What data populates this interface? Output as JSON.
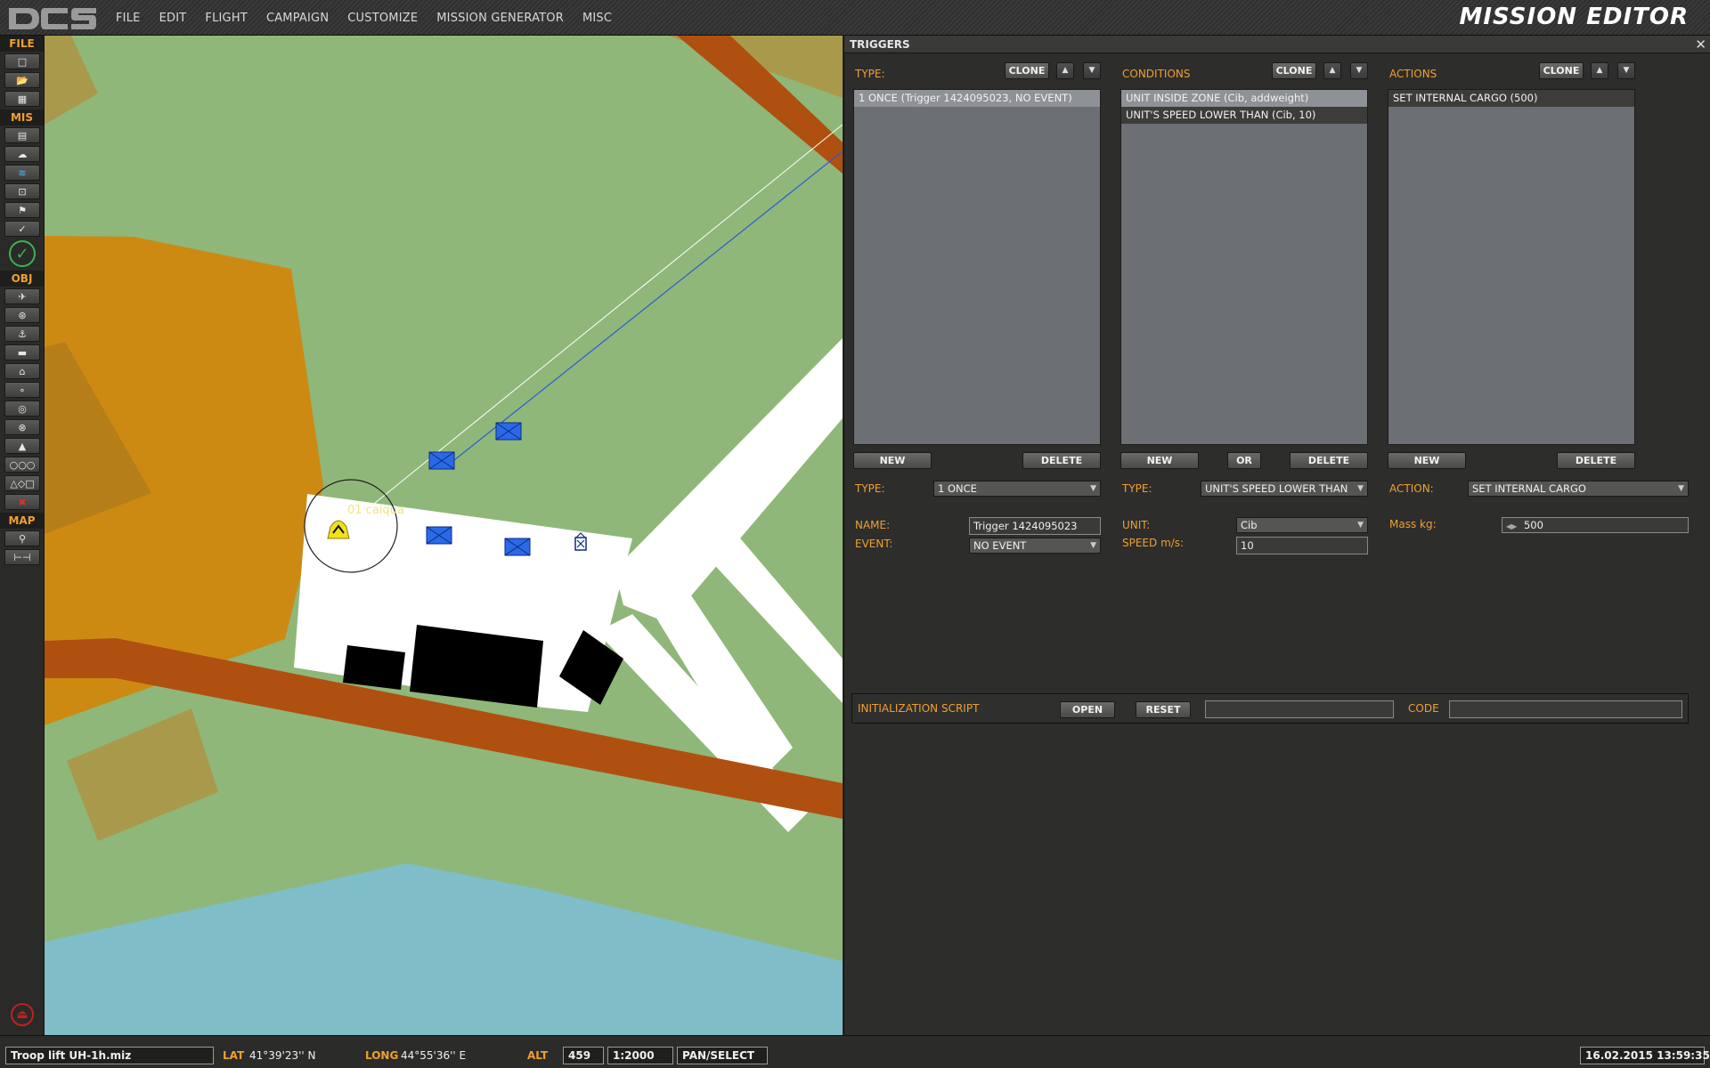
{
  "menu": {
    "items": [
      "FILE",
      "EDIT",
      "FLIGHT",
      "CAMPAIGN",
      "CUSTOMIZE",
      "MISSION GENERATOR",
      "MISC"
    ],
    "app_title": "MISSION EDITOR"
  },
  "toolbar": {
    "sections": {
      "file": "FILE",
      "mis": "MIS",
      "obj": "OBJ",
      "map": "MAP"
    },
    "file_icons": [
      "new-file-icon",
      "open-folder-icon",
      "save-icon"
    ],
    "mis_icons": [
      "briefing-icon",
      "weather-icon",
      "triggers-icon",
      "zone-icon",
      "goals-icon",
      "check-icon"
    ],
    "obj_icons": [
      "airplane-icon",
      "helicopter-icon",
      "ship-icon",
      "vehicle-icon",
      "static-icon",
      "waypoint-icon",
      "target-icon",
      "cross-target-icon",
      "beacon-icon",
      "group-icon",
      "shapes-icon",
      "delete-icon"
    ],
    "map_icons": [
      "key-icon",
      "ruler-icon"
    ],
    "accent": "#f0a030"
  },
  "map": {
    "zone_label": "01 caiqua"
  },
  "panel": {
    "title": "TRIGGERS",
    "type_column": {
      "title": "TYPE:",
      "clone": "CLONE",
      "items": [
        "1 ONCE (Trigger 1424095023, NO EVENT)"
      ],
      "new": "NEW",
      "delete": "DELETE",
      "type_label": "TYPE:",
      "type_value": "1 ONCE",
      "name_label": "NAME:",
      "name_value": "Trigger 1424095023",
      "event_label": "EVENT:",
      "event_value": "NO EVENT"
    },
    "conditions_column": {
      "title": "CONDITIONS",
      "clone": "CLONE",
      "items": [
        "UNIT INSIDE ZONE (Cib, addweight)",
        "UNIT'S SPEED LOWER THAN (Cib, 10)"
      ],
      "new": "NEW",
      "or": "OR",
      "delete": "DELETE",
      "type_label": "TYPE:",
      "type_value": "UNIT'S SPEED LOWER THAN",
      "unit_label": "UNIT:",
      "unit_value": "Cib",
      "speed_label": "SPEED m/s:",
      "speed_value": "10"
    },
    "actions_column": {
      "title": "ACTIONS",
      "clone": "CLONE",
      "items": [
        "SET INTERNAL CARGO (500)"
      ],
      "new": "NEW",
      "delete": "DELETE",
      "action_label": "ACTION:",
      "action_value": "SET INTERNAL CARGO",
      "mass_label": "Mass kg:",
      "mass_value": "500"
    },
    "init": {
      "label": "INITIALIZATION SCRIPT",
      "open": "OPEN",
      "reset": "RESET",
      "script_value": "",
      "code_label": "CODE",
      "code_value": ""
    }
  },
  "statusbar": {
    "filename": "Troop lift UH-1h.miz",
    "lat_label": "LAT",
    "lat_value": "41°39'23'' N",
    "long_label": "LONG",
    "long_value": "44°55'36'' E",
    "alt_label": "ALT",
    "alt_value": "459",
    "scale": "1:2000",
    "mode": "PAN/SELECT",
    "datetime": "16.02.2015 13:59:35"
  }
}
